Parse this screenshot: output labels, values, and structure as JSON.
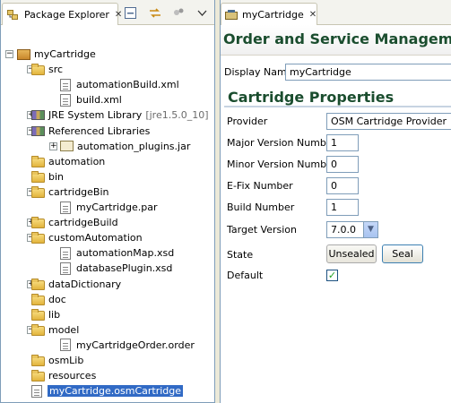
{
  "package_explorer": {
    "tab_label": "Package Explorer",
    "close_glyph": "✕",
    "tree": [
      {
        "label": "myCartridge",
        "icon": "project-icon",
        "level": 0,
        "expand": "−"
      },
      {
        "label": "src",
        "icon": "source-folder-icon",
        "level": 1,
        "expand": "−"
      },
      {
        "label": "automationBuild.xml",
        "icon": "xml-file-icon",
        "level": 2,
        "expand": ""
      },
      {
        "label": "build.xml",
        "icon": "xml-file-icon",
        "level": 2,
        "expand": ""
      },
      {
        "label": "JRE System Library",
        "suffix": "[jre1.5.0_10]",
        "icon": "library-icon",
        "level": 1,
        "expand": "+"
      },
      {
        "label": "Referenced Libraries",
        "icon": "library-icon",
        "level": 1,
        "expand": "−"
      },
      {
        "label": "automation_plugins.jar",
        "icon": "jar-icon",
        "level": 2,
        "expand": "+"
      },
      {
        "label": "automation",
        "icon": "folder-icon",
        "level": 1,
        "expand": ""
      },
      {
        "label": "bin",
        "icon": "folder-icon",
        "level": 1,
        "expand": ""
      },
      {
        "label": "cartridgeBin",
        "icon": "folder-icon",
        "level": 1,
        "expand": "−"
      },
      {
        "label": "myCartridge.par",
        "icon": "par-file-icon",
        "level": 2,
        "expand": ""
      },
      {
        "label": "cartridgeBuild",
        "icon": "folder-icon",
        "level": 1,
        "expand": "+"
      },
      {
        "label": "customAutomation",
        "icon": "folder-icon",
        "level": 1,
        "expand": "−"
      },
      {
        "label": "automationMap.xsd",
        "icon": "xsd-file-icon",
        "level": 2,
        "expand": ""
      },
      {
        "label": "databasePlugin.xsd",
        "icon": "xsd-file-icon",
        "level": 2,
        "expand": ""
      },
      {
        "label": "dataDictionary",
        "icon": "folder-icon",
        "level": 1,
        "expand": "+"
      },
      {
        "label": "doc",
        "icon": "folder-icon",
        "level": 1,
        "expand": ""
      },
      {
        "label": "lib",
        "icon": "folder-icon",
        "level": 1,
        "expand": ""
      },
      {
        "label": "model",
        "icon": "model-folder-icon",
        "level": 1,
        "expand": "−"
      },
      {
        "label": "myCartridgeOrder.order",
        "icon": "order-file-icon",
        "level": 2,
        "expand": ""
      },
      {
        "label": "osmLib",
        "icon": "folder-icon",
        "level": 1,
        "expand": ""
      },
      {
        "label": "resources",
        "icon": "folder-icon",
        "level": 1,
        "expand": ""
      },
      {
        "label": "myCartridge.osmCartridge",
        "icon": "cartridge-file-icon",
        "level": 1,
        "expand": "",
        "selected": true
      }
    ]
  },
  "editor": {
    "tab_label": "myCartridge",
    "close_glyph": "✕",
    "title": "Order and Service Management",
    "display_name_label": "Display Name",
    "display_name_value": "myCartridge",
    "section_title": "Cartridge Properties",
    "fields": {
      "provider_label": "Provider",
      "provider_value": "OSM Cartridge Provider",
      "major_label": "Major Version Number",
      "major_value": "1",
      "minor_label": "Minor Version Number",
      "minor_value": "0",
      "efix_label": "E-Fix Number",
      "efix_value": "0",
      "build_label": "Build Number",
      "build_value": "1",
      "target_label": "Target Version",
      "target_value": "7.0.0",
      "state_label": "State",
      "state_value": "Unsealed",
      "seal_button": "Seal",
      "default_label": "Default",
      "default_checked": "✓"
    }
  },
  "colors": {
    "title_green": "#1a4d2e",
    "selection_blue": "#316ac5"
  }
}
